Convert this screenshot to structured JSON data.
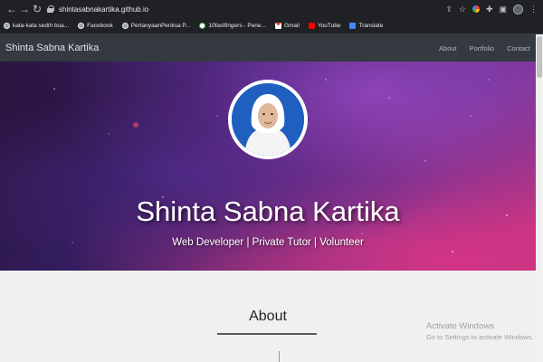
{
  "browser": {
    "url": "shintasabnakartika.github.io",
    "bookmarks": [
      {
        "label": "kata-kata sedih bua...",
        "icon": "globe-icon"
      },
      {
        "label": "Facebook",
        "icon": "globe-icon"
      },
      {
        "label": "PertanyaanPeriksa P...",
        "icon": "globe-icon"
      },
      {
        "label": "10fastfingers - Pene...",
        "icon": "tenfastfingers-icon"
      },
      {
        "label": "Gmail",
        "icon": "gmail-icon"
      },
      {
        "label": "YouTube",
        "icon": "youtube-icon"
      },
      {
        "label": "Translate",
        "icon": "translate-icon"
      }
    ]
  },
  "site": {
    "brand": "Shinta Sabna Kartika",
    "nav": [
      "About",
      "Portfolio",
      "Contact"
    ]
  },
  "hero": {
    "name": "Shinta Sabna Kartika",
    "tagline": "Web Developer | Private Tutor | Volunteer"
  },
  "about": {
    "title": "About"
  },
  "watermark": {
    "line1": "Activate Windows",
    "line2": "Go to Settings to activate Windows."
  },
  "colors": {
    "navbar": "#343a40",
    "chrome": "#202124",
    "accent_pink": "#d63384",
    "accent_purple": "#3a2270"
  }
}
